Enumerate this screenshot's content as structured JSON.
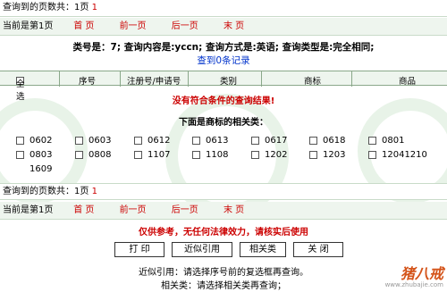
{
  "top": {
    "page_count_label": "查询到的页数共：1页",
    "page_count_value": "1",
    "current_label": "当前是第1页",
    "nav": [
      "首 页",
      "前一页",
      "后一页",
      "末 页"
    ]
  },
  "summary": {
    "text": "类号是：7; 查询内容是:yccn; 查询方式是:英语; 查询类型是:完全相同;",
    "found": "查到0条记录"
  },
  "table": {
    "select_all": "全选",
    "headers": [
      "序号",
      "注册号/申请号",
      "类别",
      "商标",
      "商品"
    ],
    "no_result": "没有符合条件的查询结果!"
  },
  "related": {
    "title": "下面是商标的相关类：",
    "items": [
      "0602",
      "0603",
      "0612",
      "0613",
      "0617",
      "0618",
      "0801",
      "0803",
      "0808",
      "1107",
      "1108",
      "1202",
      "1203",
      "12041210",
      "1609"
    ]
  },
  "bottom": {
    "page_count_label": "查询到的页数共：1页",
    "page_count_value": "1",
    "current_label": "当前是第1页",
    "nav": [
      "首 页",
      "前一页",
      "后一页",
      "末 页"
    ]
  },
  "disclaimer": "仅供参考，无任何法律效力，请核实后使用",
  "buttons": [
    "打 印",
    "近似引用",
    "相关类",
    "关 闭"
  ],
  "notes": [
    "近似引用：请选择序号前的复选框再查询。",
    "相关类：请选择相关类再查询；"
  ],
  "logo": {
    "text": "猪八戒",
    "sub": "www.zhubajie.com"
  },
  "colors": {
    "accent_red": "#cc0000",
    "link_blue": "#0033cc",
    "band_green": "#eef5ee"
  }
}
